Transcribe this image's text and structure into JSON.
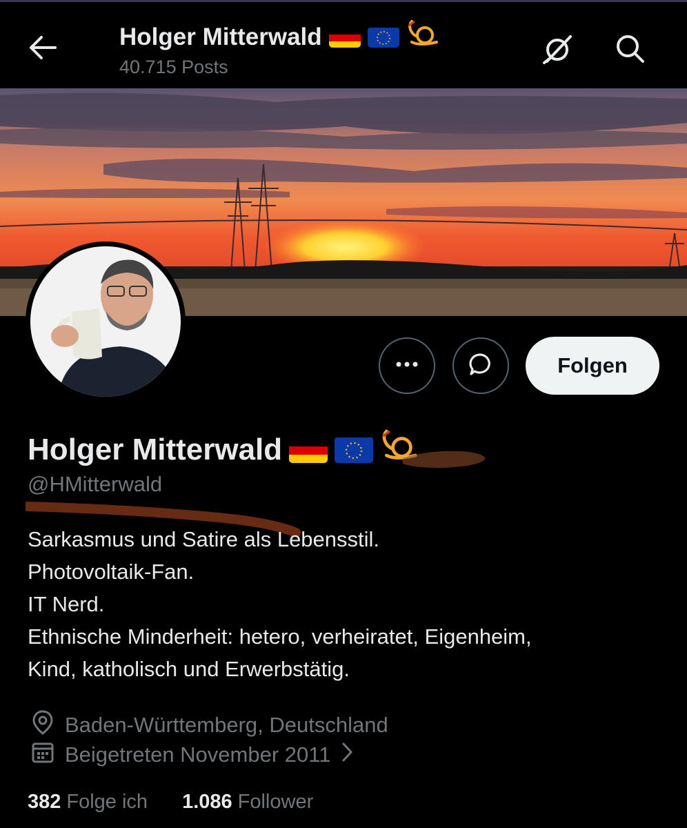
{
  "header": {
    "name": "Holger Mitterwald",
    "posts": "40.715 Posts"
  },
  "profile": {
    "name": "Holger Mitterwald",
    "handle": "@HMitterwald",
    "bio": [
      "Sarkasmus und Satire als Lebensstil.",
      "Photovoltaik-Fan.",
      "IT Nerd.",
      "Ethnische Minderheit: hetero, verheiratet, Eigenheim,",
      "Kind, katholisch und Erwerbstätig."
    ],
    "location": "Baden-Württemberg, Deutschland",
    "joined": "Beigetreten November 2011",
    "following_count": "382",
    "following_label": "Folge ich",
    "followers_count": "1.086",
    "followers_label": "Follower"
  },
  "actions": {
    "follow_label": "Folgen"
  },
  "icons": [
    "back-arrow-icon",
    "grok-icon",
    "search-icon",
    "more-icon",
    "message-icon",
    "location-icon",
    "calendar-icon",
    "chevron-right-icon",
    "flag-germany-icon",
    "flag-eu-icon",
    "posthorn-icon"
  ],
  "colors": {
    "background": "#000000",
    "text": "#e7e9ea",
    "secondary": "#71767b",
    "button_bg": "#eff3f4",
    "posthorn": "#f0a830"
  }
}
